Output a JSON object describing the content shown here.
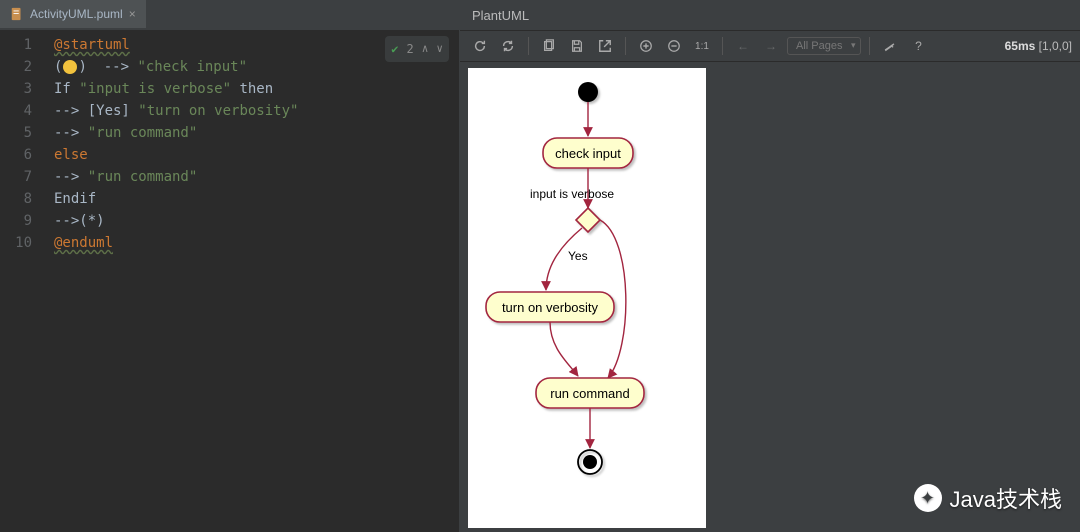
{
  "editor": {
    "tab": {
      "filename": "ActivityUML.puml"
    },
    "inspection": {
      "problems": "2"
    },
    "gutter": [
      "1",
      "2",
      "3",
      "4",
      "5",
      "6",
      "7",
      "8",
      "9",
      "10"
    ],
    "code": {
      "l1_start": "@startuml",
      "l2_a": "(",
      "l2_b": ")  --> ",
      "l2_str": "\"check input\"",
      "l3_a": "If ",
      "l3_str": "\"input is verbose\"",
      "l3_b": " then",
      "l4_a": "--> [Yes] ",
      "l4_str": "\"turn on verbosity\"",
      "l5_a": "--> ",
      "l5_str": "\"run command\"",
      "l6": "else",
      "l7_a": "--> ",
      "l7_str": "\"run command\"",
      "l8": "Endif",
      "l9": "-->(*)",
      "l10": "@enduml"
    }
  },
  "preview": {
    "title": "PlantUML",
    "toolbar": {
      "pages": "All Pages",
      "zoom11": "1:1",
      "help": "?",
      "time": "65ms",
      "coords": "[1,0,0]"
    }
  },
  "chart_data": {
    "type": "activity-diagram",
    "start": "start",
    "nodes": [
      {
        "id": "check",
        "label": "check input",
        "shape": "activity"
      },
      {
        "id": "decision",
        "label": "input is verbose",
        "shape": "decision"
      },
      {
        "id": "verbosity",
        "label": "turn on verbosity",
        "shape": "activity"
      },
      {
        "id": "run",
        "label": "run command",
        "shape": "activity"
      },
      {
        "id": "end",
        "shape": "end"
      }
    ],
    "edges": [
      {
        "from": "start",
        "to": "check"
      },
      {
        "from": "check",
        "to": "decision"
      },
      {
        "from": "decision",
        "to": "verbosity",
        "label": "Yes"
      },
      {
        "from": "decision",
        "to": "run"
      },
      {
        "from": "verbosity",
        "to": "run"
      },
      {
        "from": "run",
        "to": "end"
      }
    ]
  },
  "watermark": {
    "text": "Java技术栈"
  }
}
